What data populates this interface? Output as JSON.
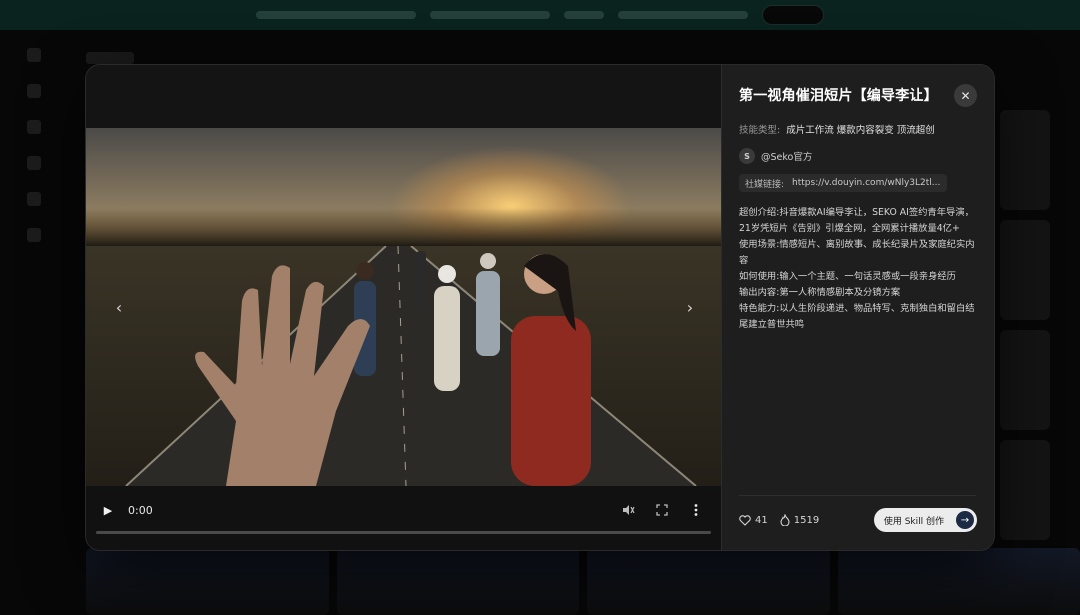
{
  "modal": {
    "title": "第一视角催泪短片【编导李让】",
    "close_icon": "close-icon",
    "skill_label": "技能类型:",
    "skill_value": "成片工作流 爆款内容裂变 顶流超创",
    "author": {
      "avatar_letter": "S",
      "handle": "@Seko官方"
    },
    "link": {
      "label": "社媒链接:",
      "url": "https://v.douyin.com/wNly3L2tl..."
    },
    "description": [
      "超创介绍:抖音爆款AI编导李让，SEKO AI签约青年导演，21岁凭短片《告别》引爆全网，全网累计播放量4亿+",
      "使用场景:情感短片、离别故事、成长纪录片及家庭纪实内容",
      "如何使用:输入一个主题、一句话灵感或一段亲身经历",
      "输出内容:第一人称情感剧本及分镜方案",
      "特色能力:以人生阶段递进、物品特写、克制独白和留白结尾建立普世共鸣"
    ],
    "stats": {
      "likes": "41",
      "uses": "1519",
      "like_icon": "heart-icon",
      "use_icon": "flame-icon"
    },
    "cta": {
      "label": "使用 Skill 创作",
      "icon": "arrow-right-icon"
    }
  },
  "video": {
    "time": "0:00",
    "progress": 0,
    "muted": true,
    "icons": [
      "play-icon",
      "mute-icon",
      "fullscreen-icon",
      "more-vertical-icon"
    ]
  },
  "colors": {
    "panel_bg": "#1e1e1f",
    "accent_button_bg": "#ececec",
    "accent_arrow_bg": "#1d2a44",
    "banner": "#0f3a33"
  }
}
